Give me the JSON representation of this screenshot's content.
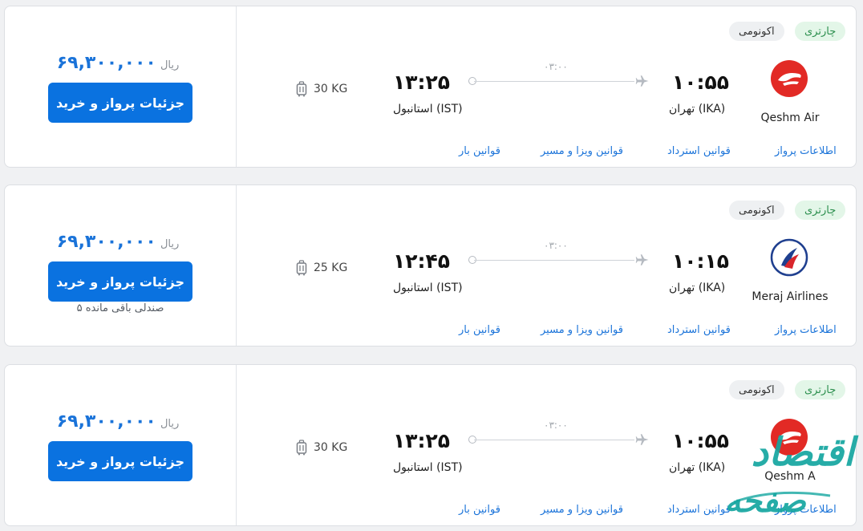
{
  "flights": [
    {
      "badge_charter": "چارتری",
      "badge_class": "اکونومی",
      "airline": "Qeshm Air",
      "logo": "qeshm-air-logo",
      "dep_time": "۱۰:۵۵",
      "arr_time": "۱۳:۲۵",
      "dep_city": "تهران (IKA)",
      "arr_city": "استانبول (IST)",
      "duration": "۰۳:۰۰",
      "baggage": "30 KG",
      "price": "۶۹,۳۰۰,۰۰۰",
      "currency": "ریال",
      "buy_label": "جزئیات پرواز و خرید",
      "seats": "",
      "links": [
        "اطلاعات پرواز",
        "قوانین استرداد",
        "قوانین ویزا و مسیر",
        "قوانین بار"
      ]
    },
    {
      "badge_charter": "چارتری",
      "badge_class": "اکونومی",
      "airline": "Meraj Airlines",
      "logo": "meraj-airlines-logo",
      "dep_time": "۱۰:۱۵",
      "arr_time": "۱۲:۴۵",
      "dep_city": "تهران (IKA)",
      "arr_city": "استانبول (IST)",
      "duration": "۰۳:۰۰",
      "baggage": "25 KG",
      "price": "۶۹,۳۰۰,۰۰۰",
      "currency": "ریال",
      "buy_label": "جزئیات پرواز و خرید",
      "seats": "۵ صندلی باقی مانده",
      "links": [
        "اطلاعات پرواز",
        "قوانین استرداد",
        "قوانین ویزا و مسیر",
        "قوانین بار"
      ]
    },
    {
      "badge_charter": "چارتری",
      "badge_class": "اکونومی",
      "airline": "Qeshm A",
      "logo": "qeshm-air-logo",
      "dep_time": "۱۰:۵۵",
      "arr_time": "۱۳:۲۵",
      "dep_city": "تهران (IKA)",
      "arr_city": "استانبول (IST)",
      "duration": "۰۳:۰۰",
      "baggage": "30 KG",
      "price": "۶۹,۳۰۰,۰۰۰",
      "currency": "ریال",
      "buy_label": "جزئیات پرواز و خرید",
      "seats": "",
      "links": [
        "اطلاعات پرواز",
        "قوانین استرداد",
        "قوانین ویزا و مسیر",
        "قوانین بار"
      ]
    }
  ],
  "watermark": "صفحه اقتصاد",
  "colors": {
    "primary": "#0a72e0",
    "price": "#1a73d9",
    "charter_bg": "#e3f6e8",
    "charter_text": "#2c8f4e",
    "qeshm_red": "#e22a25",
    "meraj_blue": "#1f3f8f",
    "watermark": "#14a6a0"
  }
}
